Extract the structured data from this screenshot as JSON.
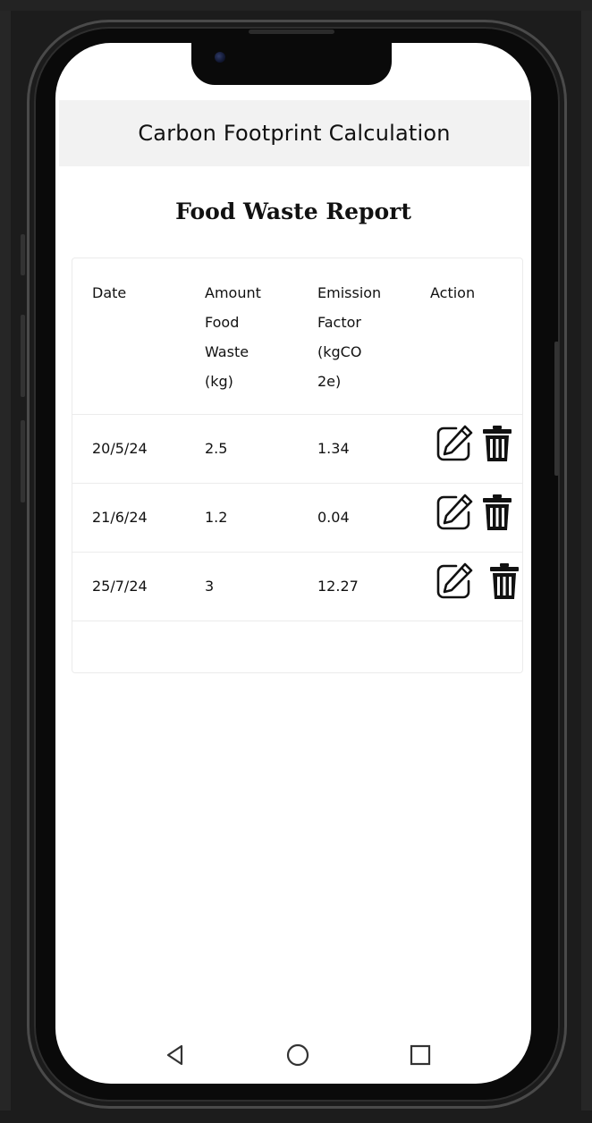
{
  "app": {
    "title": "Carbon Footprint Calculation"
  },
  "report": {
    "title": "Food Waste Report",
    "columns": [
      "Date",
      "Amount\nFood\nWaste\n(kg)",
      "Emission\nFactor\n(kgCO\n2e)",
      "Action"
    ],
    "rows": [
      {
        "date": "20/5/24",
        "amount": "2.5",
        "factor": "1.34"
      },
      {
        "date": "21/6/24",
        "amount": "1.2",
        "factor": "0.04"
      },
      {
        "date": "25/7/24",
        "amount": "3",
        "factor": "12.27"
      }
    ]
  },
  "icons": {
    "edit": "edit-icon",
    "delete": "trash-icon",
    "back": "back-triangle-icon",
    "home": "home-circle-icon",
    "recents": "recents-square-icon"
  }
}
